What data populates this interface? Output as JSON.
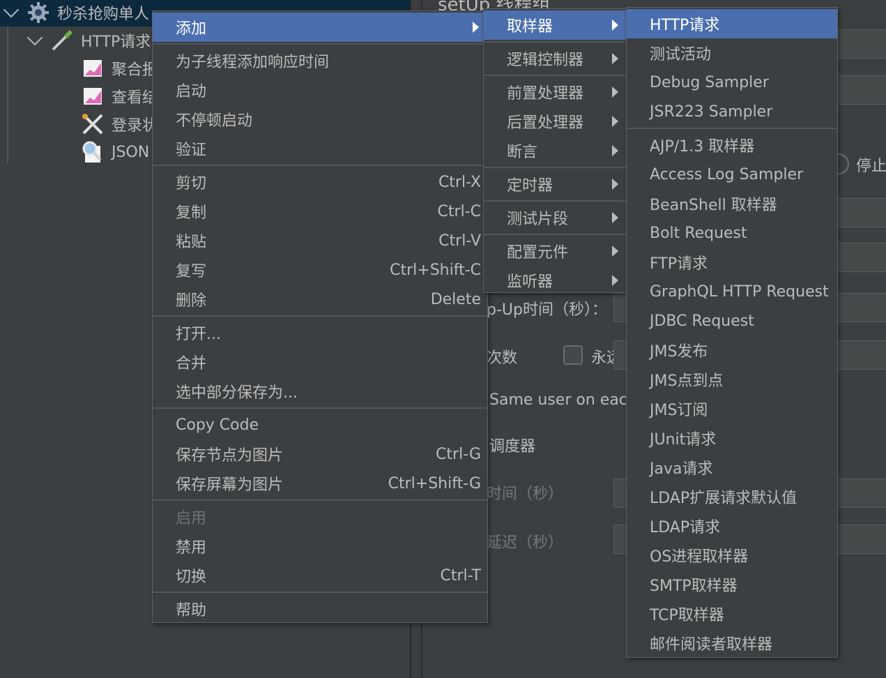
{
  "tree": {
    "items": [
      {
        "label": "秒杀抢购单人",
        "icon": "gear-icon"
      },
      {
        "label": "HTTP请求",
        "icon": "pipette-icon"
      },
      {
        "label": "聚合报",
        "icon": "chart-icon"
      },
      {
        "label": "查看结",
        "icon": "chart-icon"
      },
      {
        "label": "登录状",
        "icon": "tools-icon"
      },
      {
        "label": "JSON",
        "icon": "magnifier-icon"
      }
    ]
  },
  "panel": {
    "title": "setUp 线程组",
    "stop_label": "停止",
    "rampup_label": "p-Up时间（秒）：",
    "loop_label": "次数",
    "forever_label": "永远",
    "same_user_label": "Same user on each",
    "scheduler_label": "调度器",
    "duration_label": "时间（秒）",
    "delay_label": "延迟（秒）"
  },
  "menu_main": {
    "items": [
      {
        "label": "添加",
        "submenu": true,
        "active": true
      },
      {
        "sep": true
      },
      {
        "label": "为子线程添加响应时间"
      },
      {
        "label": "启动"
      },
      {
        "label": "不停顿启动"
      },
      {
        "label": "验证"
      },
      {
        "sep": true
      },
      {
        "label": "剪切",
        "shortcut": "Ctrl-X"
      },
      {
        "label": "复制",
        "shortcut": "Ctrl-C"
      },
      {
        "label": "粘贴",
        "shortcut": "Ctrl-V"
      },
      {
        "label": "复写",
        "shortcut": "Ctrl+Shift-C"
      },
      {
        "label": "删除",
        "shortcut": "Delete"
      },
      {
        "sep": true
      },
      {
        "label": "打开..."
      },
      {
        "label": "合并"
      },
      {
        "label": "选中部分保存为..."
      },
      {
        "sep": true
      },
      {
        "label": "Copy Code"
      },
      {
        "label": "保存节点为图片",
        "shortcut": "Ctrl-G"
      },
      {
        "label": "保存屏幕为图片",
        "shortcut": "Ctrl+Shift-G"
      },
      {
        "sep": true
      },
      {
        "label": "启用",
        "disabled": true
      },
      {
        "label": "禁用"
      },
      {
        "label": "切换",
        "shortcut": "Ctrl-T"
      },
      {
        "sep": true
      },
      {
        "label": "帮助"
      }
    ]
  },
  "menu_add": {
    "items": [
      {
        "label": "取样器",
        "submenu": true,
        "active": true
      },
      {
        "sep": true
      },
      {
        "label": "逻辑控制器",
        "submenu": true
      },
      {
        "sep": true
      },
      {
        "label": "前置处理器",
        "submenu": true
      },
      {
        "label": "后置处理器",
        "submenu": true
      },
      {
        "label": "断言",
        "submenu": true
      },
      {
        "sep": true
      },
      {
        "label": "定时器",
        "submenu": true
      },
      {
        "sep": true
      },
      {
        "label": "测试片段",
        "submenu": true
      },
      {
        "sep": true
      },
      {
        "label": "配置元件",
        "submenu": true
      },
      {
        "label": "监听器",
        "submenu": true
      }
    ]
  },
  "menu_sampler": {
    "items": [
      {
        "label": "HTTP请求",
        "active": true
      },
      {
        "label": "测试活动"
      },
      {
        "label": "Debug Sampler"
      },
      {
        "label": "JSR223 Sampler"
      },
      {
        "sep": true
      },
      {
        "label": "AJP/1.3 取样器"
      },
      {
        "label": "Access Log Sampler"
      },
      {
        "label": "BeanShell 取样器"
      },
      {
        "label": "Bolt Request"
      },
      {
        "label": "FTP请求"
      },
      {
        "label": "GraphQL HTTP Request"
      },
      {
        "label": "JDBC Request"
      },
      {
        "label": "JMS发布"
      },
      {
        "label": "JMS点到点"
      },
      {
        "label": "JMS订阅"
      },
      {
        "label": "JUnit请求"
      },
      {
        "label": "Java请求"
      },
      {
        "label": "LDAP扩展请求默认值"
      },
      {
        "label": "LDAP请求"
      },
      {
        "label": "OS进程取样器"
      },
      {
        "label": "SMTP取样器"
      },
      {
        "label": "TCP取样器"
      },
      {
        "label": "邮件阅读者取样器"
      }
    ]
  }
}
